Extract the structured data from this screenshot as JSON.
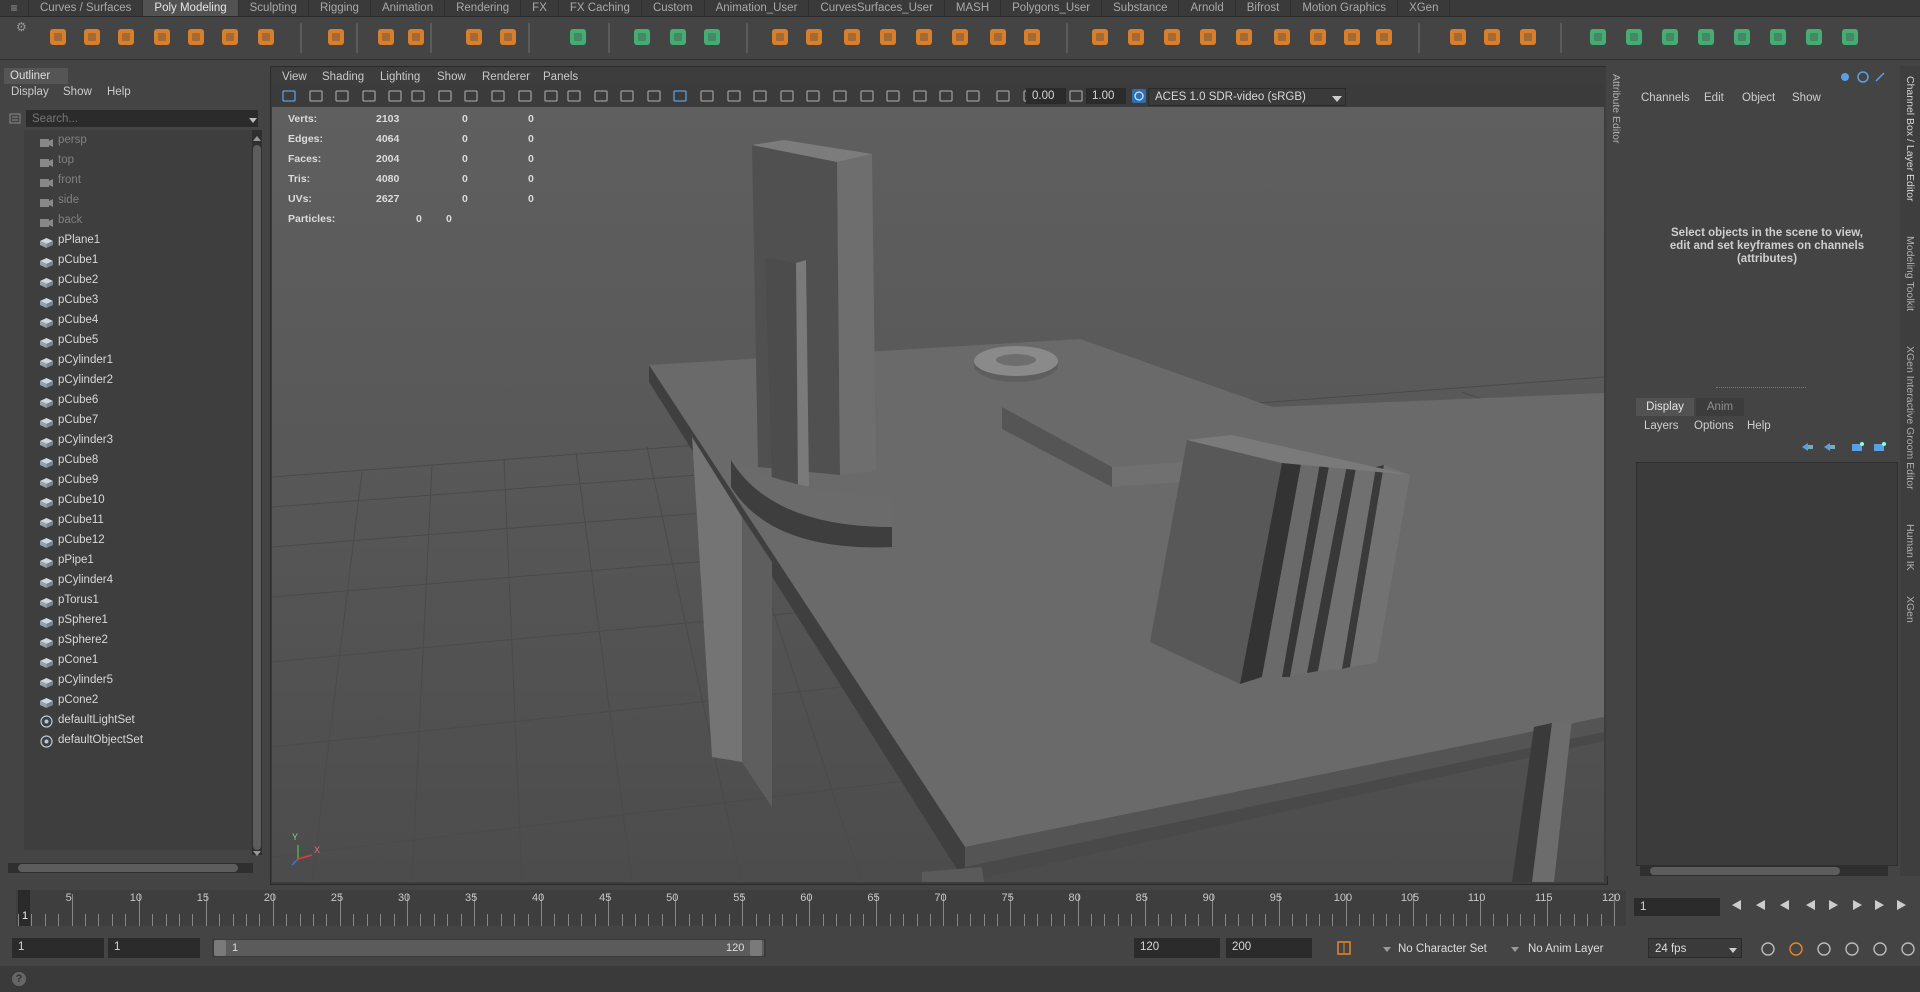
{
  "shelf": {
    "menu_glyph": "≡",
    "tabs": [
      "Curves / Surfaces",
      "Poly Modeling",
      "Sculpting",
      "Rigging",
      "Animation",
      "Rendering",
      "FX",
      "FX Caching",
      "Custom",
      "Animation_User",
      "CurvesSurfaces_User",
      "MASH",
      "Polygons_User",
      "Substance",
      "Arnold",
      "Bifrost",
      "Motion Graphics",
      "XGen"
    ],
    "active_tab": "Poly Modeling",
    "accent_color": "#e8862a",
    "green_accent": "#46b87a"
  },
  "outliner": {
    "title": "Outliner",
    "menus": [
      "Display",
      "Show",
      "Help"
    ],
    "search_placeholder": "Search...",
    "items": [
      {
        "label": "persp",
        "type": "camera"
      },
      {
        "label": "top",
        "type": "camera"
      },
      {
        "label": "front",
        "type": "camera"
      },
      {
        "label": "side",
        "type": "camera"
      },
      {
        "label": "back",
        "type": "camera"
      },
      {
        "label": "pPlane1",
        "type": "mesh"
      },
      {
        "label": "pCube1",
        "type": "mesh"
      },
      {
        "label": "pCube2",
        "type": "mesh"
      },
      {
        "label": "pCube3",
        "type": "mesh"
      },
      {
        "label": "pCube4",
        "type": "mesh"
      },
      {
        "label": "pCube5",
        "type": "mesh"
      },
      {
        "label": "pCylinder1",
        "type": "mesh"
      },
      {
        "label": "pCylinder2",
        "type": "mesh"
      },
      {
        "label": "pCube6",
        "type": "mesh"
      },
      {
        "label": "pCube7",
        "type": "mesh"
      },
      {
        "label": "pCylinder3",
        "type": "mesh"
      },
      {
        "label": "pCube8",
        "type": "mesh"
      },
      {
        "label": "pCube9",
        "type": "mesh"
      },
      {
        "label": "pCube10",
        "type": "mesh"
      },
      {
        "label": "pCube11",
        "type": "mesh"
      },
      {
        "label": "pCube12",
        "type": "mesh"
      },
      {
        "label": "pPipe1",
        "type": "mesh"
      },
      {
        "label": "pCylinder4",
        "type": "mesh"
      },
      {
        "label": "pTorus1",
        "type": "mesh"
      },
      {
        "label": "pSphere1",
        "type": "mesh"
      },
      {
        "label": "pSphere2",
        "type": "mesh"
      },
      {
        "label": "pCone1",
        "type": "mesh"
      },
      {
        "label": "pCylinder5",
        "type": "mesh"
      },
      {
        "label": "pCone2",
        "type": "mesh"
      },
      {
        "label": "defaultLightSet",
        "type": "set"
      },
      {
        "label": "defaultObjectSet",
        "type": "set"
      }
    ]
  },
  "viewport": {
    "menus": [
      "View",
      "Shading",
      "Lighting",
      "Show",
      "Renderer",
      "Panels"
    ],
    "exposure": "0.00",
    "gamma": "1.00",
    "color_space": "ACES 1.0 SDR-video (sRGB)",
    "hud": [
      {
        "label": "Verts:",
        "values": [
          "2103",
          "0",
          "0"
        ]
      },
      {
        "label": "Edges:",
        "values": [
          "4064",
          "0",
          "0"
        ]
      },
      {
        "label": "Faces:",
        "values": [
          "2004",
          "0",
          "0"
        ]
      },
      {
        "label": "Tris:",
        "values": [
          "4080",
          "0",
          "0"
        ]
      },
      {
        "label": "UVs:",
        "values": [
          "2627",
          "0",
          "0"
        ]
      },
      {
        "label": "Particles:",
        "values": [
          "0",
          "0"
        ]
      }
    ],
    "axis_labels": {
      "y": "Y",
      "x": "X"
    }
  },
  "side_tabs": [
    "Attribute Editor",
    "Channel Box / Layer Editor",
    "Modeling Toolkit",
    "XGen Interactive Groom Editor",
    "Human IK",
    "XGen"
  ],
  "channel_box": {
    "menus": [
      "Channels",
      "Edit",
      "Object",
      "Show"
    ],
    "message": "Select objects in the scene to view, edit and set keyframes on channels (attributes)"
  },
  "layer_editor": {
    "tabs": [
      "Display",
      "Anim"
    ],
    "menus": [
      "Layers",
      "Options",
      "Help"
    ]
  },
  "timeline": {
    "ticks": [
      "5",
      "10",
      "15",
      "20",
      "25",
      "30",
      "35",
      "40",
      "45",
      "50",
      "55",
      "60",
      "65",
      "70",
      "75",
      "80",
      "85",
      "90",
      "95",
      "100",
      "105",
      "110",
      "115",
      "120"
    ],
    "current_frame": "1",
    "current_frame_field": "1"
  },
  "range": {
    "start_field": "1",
    "anim_start_field": "1",
    "slider_start": "1",
    "slider_end": "120",
    "end_field": "120",
    "anim_end_field": "200",
    "character_set": "No Character Set",
    "anim_layer": "No Anim Layer",
    "fps": "24 fps"
  },
  "status": {
    "help_glyph": "?"
  }
}
